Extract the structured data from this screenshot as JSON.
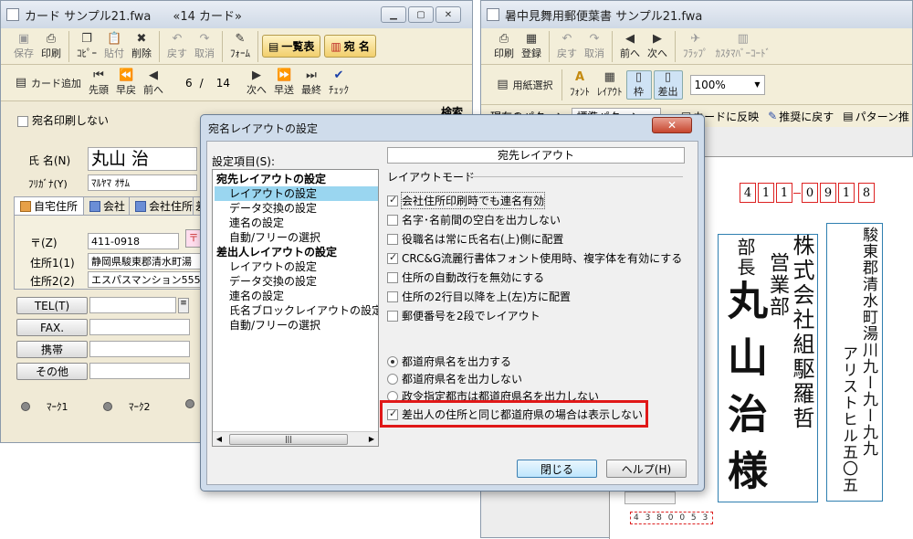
{
  "left_window": {
    "title": "カード サンプル21.fwa",
    "count": "«14 カード»",
    "toolbar1": [
      {
        "label": "保存",
        "icon": "save-icon",
        "glyph": "▣",
        "enabled": false
      },
      {
        "label": "印刷",
        "icon": "printer-icon",
        "glyph": "⎙",
        "enabled": true
      },
      {
        "label": "ｺﾋﾟｰ",
        "icon": "copy-icon",
        "glyph": "❐",
        "enabled": true
      },
      {
        "label": "貼付",
        "icon": "paste-icon",
        "glyph": "📋",
        "enabled": false
      },
      {
        "label": "削除",
        "icon": "delete-icon",
        "glyph": "✖",
        "enabled": true
      },
      {
        "label": "戻す",
        "icon": "undo-icon",
        "glyph": "↶",
        "enabled": false
      },
      {
        "label": "取消",
        "icon": "redo-icon",
        "glyph": "↷",
        "enabled": false
      },
      {
        "label": "ﾌｫｰﾑ",
        "icon": "form-icon",
        "glyph": "✎",
        "enabled": true
      }
    ],
    "list_button": "一覧表",
    "address_button": "宛 名",
    "toolbar2": {
      "add_card": "カード追加",
      "first": "先頭",
      "fast_back": "早戻",
      "prev": "前へ",
      "page_current": "6",
      "page_sep": "/",
      "page_total": "14",
      "next": "次へ",
      "fast_fwd": "早送",
      "last": "最終",
      "check": "ﾁｪｯｸ"
    },
    "search_label": "検索",
    "no_print_label": "宛名印刷しない",
    "name_label": "氏 名(N)",
    "name_value": "丸山 治",
    "kana_label": "ﾌﾘｶﾞﾅ(Y)",
    "kana_value": "ﾏﾙﾔﾏ ｵｻﾑ",
    "tabs": [
      "自宅住所",
      "会社",
      "会社住所",
      "差"
    ],
    "zip_label": "〒(Z)",
    "zip_value": "411-0918",
    "addr1_label": "住所1(1)",
    "addr1_value": "静岡県駿東郡清水町湯",
    "addr2_label": "住所2(2)",
    "addr2_value": "エスパスマンション555",
    "tel_label": "TEL(T)",
    "fax_label": "FAX.",
    "mobile_label": "携帯",
    "other_label": "その他",
    "mark1": "ﾏｰｸ1",
    "mark2": "ﾏｰｸ2"
  },
  "right_window": {
    "title": "暑中見舞用郵便葉書 サンプル21.fwa",
    "toolbar1": [
      {
        "label": "印刷",
        "icon": "printer-icon",
        "glyph": "⎙",
        "enabled": true
      },
      {
        "label": "登録",
        "icon": "register-icon",
        "glyph": "▦",
        "enabled": true
      },
      {
        "label": "戻す",
        "icon": "undo-icon",
        "glyph": "↶",
        "enabled": false
      },
      {
        "label": "取消",
        "icon": "redo-icon",
        "glyph": "↷",
        "enabled": false
      },
      {
        "label": "前へ",
        "icon": "prev-icon",
        "glyph": "◀",
        "enabled": true
      },
      {
        "label": "次へ",
        "icon": "next-icon",
        "glyph": "▶",
        "enabled": true
      },
      {
        "label": "ﾌﾗｯﾌﾟ",
        "icon": "flap-icon",
        "glyph": "✈",
        "enabled": false
      },
      {
        "label": "ｶｽﾀﾏﾊﾞｰｺｰﾄﾞ",
        "icon": "barcode-icon",
        "glyph": "▥",
        "enabled": false
      }
    ],
    "toolbar2": [
      {
        "label": "用紙選択",
        "icon": "paper-select-icon",
        "glyph": "▤"
      },
      {
        "label": "ﾌｫﾝﾄ",
        "icon": "font-icon",
        "glyph": "A"
      },
      {
        "label": "ﾚｲｱｳﾄ",
        "icon": "layout-icon",
        "glyph": "▦"
      },
      {
        "label": "枠",
        "icon": "frame-icon",
        "glyph": "▯"
      },
      {
        "label": "差出",
        "icon": "sender-icon",
        "glyph": "▯"
      }
    ],
    "zoom": "100%",
    "pattern_label": "現在のパターン",
    "pattern_value": "標準パターン",
    "reflect_card": "カードに反映",
    "restore_recommended": "推奨に戻す",
    "pattern_prefix": "パターン推",
    "postcode_digits": [
      "4",
      "1",
      "1",
      "0",
      "9",
      "1",
      "8"
    ],
    "recipient_address": "駿東郡清水町湯川九ー九ー九九",
    "recipient_building": "アリストヒル五〇五",
    "recipient_company": "株式会社組駆羅哲",
    "recipient_dept": "営業部",
    "recipient_title": "部長",
    "recipient_name": "丸山治様",
    "sender_zip": "4 3 8 0 0 5 3"
  },
  "dialog": {
    "title": "宛名レイアウトの設定",
    "settings_label": "設定項目(S):",
    "tree": [
      {
        "label": "宛先レイアウトの設定",
        "level": 0,
        "selected": false
      },
      {
        "label": "レイアウトの設定",
        "level": 1,
        "selected": true
      },
      {
        "label": "データ交換の設定",
        "level": 1,
        "selected": false
      },
      {
        "label": "連名の設定",
        "level": 1,
        "selected": false
      },
      {
        "label": "自動/フリーの選択",
        "level": 1,
        "selected": false
      },
      {
        "label": "差出人レイアウトの設定",
        "level": 0,
        "selected": false
      },
      {
        "label": "レイアウトの設定",
        "level": 1,
        "selected": false
      },
      {
        "label": "データ交換の設定",
        "level": 1,
        "selected": false
      },
      {
        "label": "連名の設定",
        "level": 1,
        "selected": false
      },
      {
        "label": "氏名ブロックレイアウトの設定",
        "level": 1,
        "selected": false
      },
      {
        "label": "自動/フリーの選択",
        "level": 1,
        "selected": false
      }
    ],
    "panel_title": "宛先レイアウト",
    "mode_label": "レイアウトモード",
    "checkboxes": [
      {
        "label": "会社住所印刷時でも連名有効",
        "checked": true
      },
      {
        "label": "名字･名前間の空白を出力しない",
        "checked": false
      },
      {
        "label": "役職名は常に氏名右(上)側に配置",
        "checked": false
      },
      {
        "label": "CRC&G流麗行書体フォント使用時、複字体を有効にする",
        "checked": true
      },
      {
        "label": "住所の自動改行を無効にする",
        "checked": false
      },
      {
        "label": "住所の2行目以降を上(左)方に配置",
        "checked": false
      },
      {
        "label": "郵便番号を2段でレイアウト",
        "checked": false
      }
    ],
    "radios": [
      {
        "label": "都道府県名を出力する",
        "checked": true
      },
      {
        "label": "都道府県名を出力しない",
        "checked": false
      },
      {
        "label": "政令指定都市は都道府県名を出力しない",
        "checked": false
      }
    ],
    "highlight_checkbox": {
      "label": "差出人の住所と同じ都道府県の場合は表示しない",
      "checked": true
    },
    "highlight_color": "#e01818",
    "close_button": "閉じる",
    "help_button": "ヘルプ(H)",
    "close_icon": "close-icon"
  }
}
